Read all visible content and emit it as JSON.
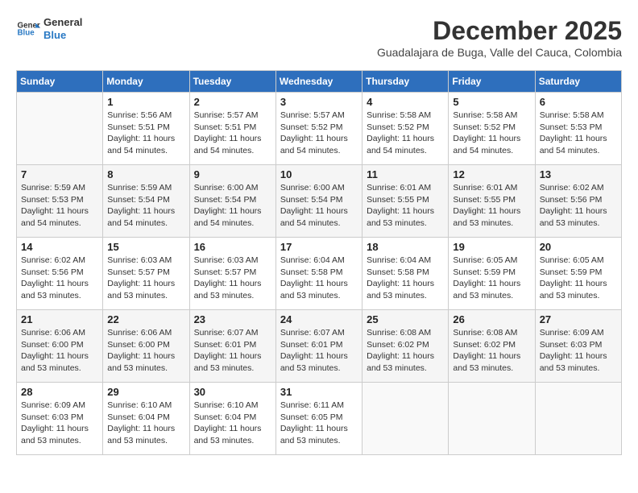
{
  "header": {
    "logo_line1": "General",
    "logo_line2": "Blue",
    "title": "December 2025",
    "subtitle": "Guadalajara de Buga, Valle del Cauca, Colombia"
  },
  "calendar": {
    "days_of_week": [
      "Sunday",
      "Monday",
      "Tuesday",
      "Wednesday",
      "Thursday",
      "Friday",
      "Saturday"
    ],
    "weeks": [
      [
        {
          "day": "",
          "sunrise": "",
          "sunset": "",
          "daylight": ""
        },
        {
          "day": "1",
          "sunrise": "5:56 AM",
          "sunset": "5:51 PM",
          "daylight": "11 hours and 54 minutes."
        },
        {
          "day": "2",
          "sunrise": "5:57 AM",
          "sunset": "5:51 PM",
          "daylight": "11 hours and 54 minutes."
        },
        {
          "day": "3",
          "sunrise": "5:57 AM",
          "sunset": "5:52 PM",
          "daylight": "11 hours and 54 minutes."
        },
        {
          "day": "4",
          "sunrise": "5:58 AM",
          "sunset": "5:52 PM",
          "daylight": "11 hours and 54 minutes."
        },
        {
          "day": "5",
          "sunrise": "5:58 AM",
          "sunset": "5:52 PM",
          "daylight": "11 hours and 54 minutes."
        },
        {
          "day": "6",
          "sunrise": "5:58 AM",
          "sunset": "5:53 PM",
          "daylight": "11 hours and 54 minutes."
        }
      ],
      [
        {
          "day": "7",
          "sunrise": "5:59 AM",
          "sunset": "5:53 PM",
          "daylight": "11 hours and 54 minutes."
        },
        {
          "day": "8",
          "sunrise": "5:59 AM",
          "sunset": "5:54 PM",
          "daylight": "11 hours and 54 minutes."
        },
        {
          "day": "9",
          "sunrise": "6:00 AM",
          "sunset": "5:54 PM",
          "daylight": "11 hours and 54 minutes."
        },
        {
          "day": "10",
          "sunrise": "6:00 AM",
          "sunset": "5:54 PM",
          "daylight": "11 hours and 54 minutes."
        },
        {
          "day": "11",
          "sunrise": "6:01 AM",
          "sunset": "5:55 PM",
          "daylight": "11 hours and 53 minutes."
        },
        {
          "day": "12",
          "sunrise": "6:01 AM",
          "sunset": "5:55 PM",
          "daylight": "11 hours and 53 minutes."
        },
        {
          "day": "13",
          "sunrise": "6:02 AM",
          "sunset": "5:56 PM",
          "daylight": "11 hours and 53 minutes."
        }
      ],
      [
        {
          "day": "14",
          "sunrise": "6:02 AM",
          "sunset": "5:56 PM",
          "daylight": "11 hours and 53 minutes."
        },
        {
          "day": "15",
          "sunrise": "6:03 AM",
          "sunset": "5:57 PM",
          "daylight": "11 hours and 53 minutes."
        },
        {
          "day": "16",
          "sunrise": "6:03 AM",
          "sunset": "5:57 PM",
          "daylight": "11 hours and 53 minutes."
        },
        {
          "day": "17",
          "sunrise": "6:04 AM",
          "sunset": "5:58 PM",
          "daylight": "11 hours and 53 minutes."
        },
        {
          "day": "18",
          "sunrise": "6:04 AM",
          "sunset": "5:58 PM",
          "daylight": "11 hours and 53 minutes."
        },
        {
          "day": "19",
          "sunrise": "6:05 AM",
          "sunset": "5:59 PM",
          "daylight": "11 hours and 53 minutes."
        },
        {
          "day": "20",
          "sunrise": "6:05 AM",
          "sunset": "5:59 PM",
          "daylight": "11 hours and 53 minutes."
        }
      ],
      [
        {
          "day": "21",
          "sunrise": "6:06 AM",
          "sunset": "6:00 PM",
          "daylight": "11 hours and 53 minutes."
        },
        {
          "day": "22",
          "sunrise": "6:06 AM",
          "sunset": "6:00 PM",
          "daylight": "11 hours and 53 minutes."
        },
        {
          "day": "23",
          "sunrise": "6:07 AM",
          "sunset": "6:01 PM",
          "daylight": "11 hours and 53 minutes."
        },
        {
          "day": "24",
          "sunrise": "6:07 AM",
          "sunset": "6:01 PM",
          "daylight": "11 hours and 53 minutes."
        },
        {
          "day": "25",
          "sunrise": "6:08 AM",
          "sunset": "6:02 PM",
          "daylight": "11 hours and 53 minutes."
        },
        {
          "day": "26",
          "sunrise": "6:08 AM",
          "sunset": "6:02 PM",
          "daylight": "11 hours and 53 minutes."
        },
        {
          "day": "27",
          "sunrise": "6:09 AM",
          "sunset": "6:03 PM",
          "daylight": "11 hours and 53 minutes."
        }
      ],
      [
        {
          "day": "28",
          "sunrise": "6:09 AM",
          "sunset": "6:03 PM",
          "daylight": "11 hours and 53 minutes."
        },
        {
          "day": "29",
          "sunrise": "6:10 AM",
          "sunset": "6:04 PM",
          "daylight": "11 hours and 53 minutes."
        },
        {
          "day": "30",
          "sunrise": "6:10 AM",
          "sunset": "6:04 PM",
          "daylight": "11 hours and 53 minutes."
        },
        {
          "day": "31",
          "sunrise": "6:11 AM",
          "sunset": "6:05 PM",
          "daylight": "11 hours and 53 minutes."
        },
        {
          "day": "",
          "sunrise": "",
          "sunset": "",
          "daylight": ""
        },
        {
          "day": "",
          "sunrise": "",
          "sunset": "",
          "daylight": ""
        },
        {
          "day": "",
          "sunrise": "",
          "sunset": "",
          "daylight": ""
        }
      ]
    ]
  }
}
